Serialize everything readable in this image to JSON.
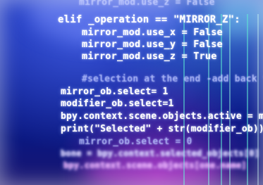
{
  "code_lines": [
    "mirror_mod.use_z = False",
    "elif _operation == \"MIRROR_Z\":",
    "mirror_mod.use_x = False",
    "mirror_mod.use_y = False",
    "mirror_mod.use_z = True",
    "#selection at the end -add back the",
    "mirror_ob.select= 1",
    "modifier_ob.select=1",
    "bpy.context.scene.objects.active = modi",
    "print(\"Selected\" + str(modifier_ob)) #",
    "mirror_ob.select = 0",
    "bone = bpy.context.selected_objects[0]",
    "bpy.context.scene.objects[one.name]"
  ]
}
